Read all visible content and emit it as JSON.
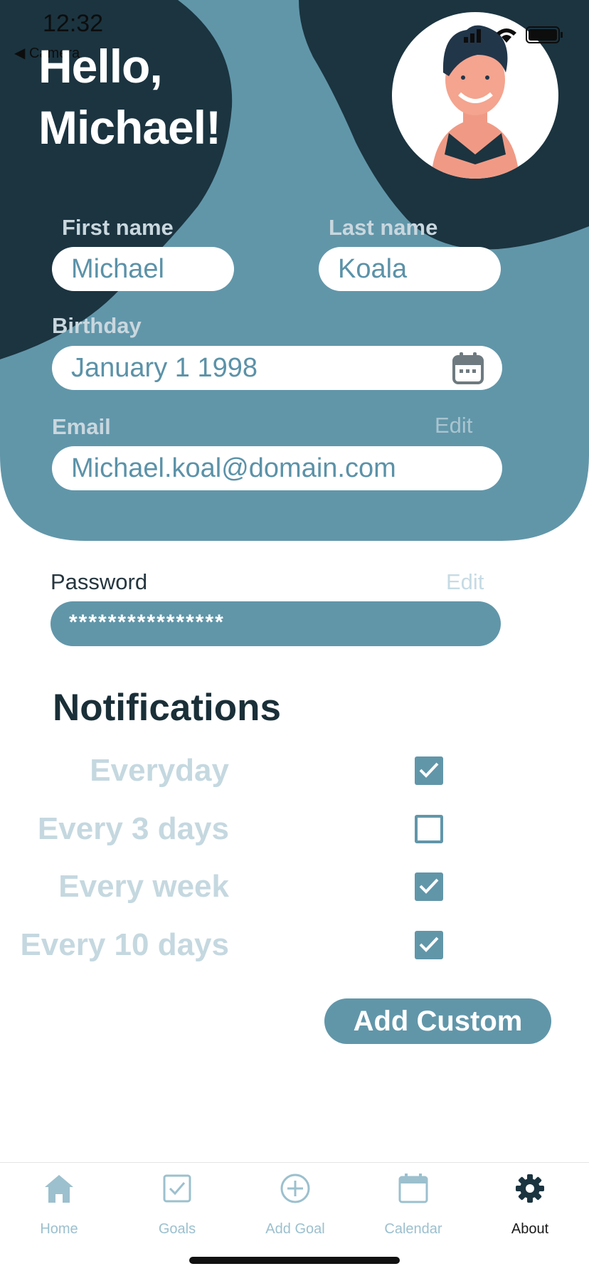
{
  "status_bar": {
    "time": "12:32",
    "back_label": "Camera"
  },
  "greeting": {
    "line1": "Hello,",
    "line2": "Michael!"
  },
  "profile": {
    "first_name": {
      "label": "First name",
      "value": "Michael"
    },
    "last_name": {
      "label": "Last name",
      "value": "Koala"
    },
    "birthday": {
      "label": "Birthday",
      "value": "January 1 1998"
    },
    "email": {
      "label": "Email",
      "edit_label": "Edit",
      "value": "Michael.koal@domain.com"
    },
    "password": {
      "label": "Password",
      "edit_label": "Edit",
      "value": "****************"
    }
  },
  "notifications": {
    "title": "Notifications",
    "options": [
      {
        "label": "Everyday",
        "checked": true
      },
      {
        "label": "Every 3 days",
        "checked": false
      },
      {
        "label": "Every week",
        "checked": true
      },
      {
        "label": "Every 10 days",
        "checked": true
      }
    ],
    "add_custom_label": "Add Custom"
  },
  "tabs": [
    {
      "label": "Home",
      "icon": "home-icon",
      "active": false
    },
    {
      "label": "Goals",
      "icon": "checkbox-icon",
      "active": false
    },
    {
      "label": "Add Goal",
      "icon": "plus-circle-icon",
      "active": false
    },
    {
      "label": "Calendar",
      "icon": "calendar-icon",
      "active": false
    },
    {
      "label": "About",
      "icon": "gear-icon",
      "active": true
    }
  ],
  "colors": {
    "primary": "#6196a9",
    "dark_blob": "#1b3440",
    "tab_inactive": "#9cc0ce",
    "option_label": "#c5d8e0"
  }
}
